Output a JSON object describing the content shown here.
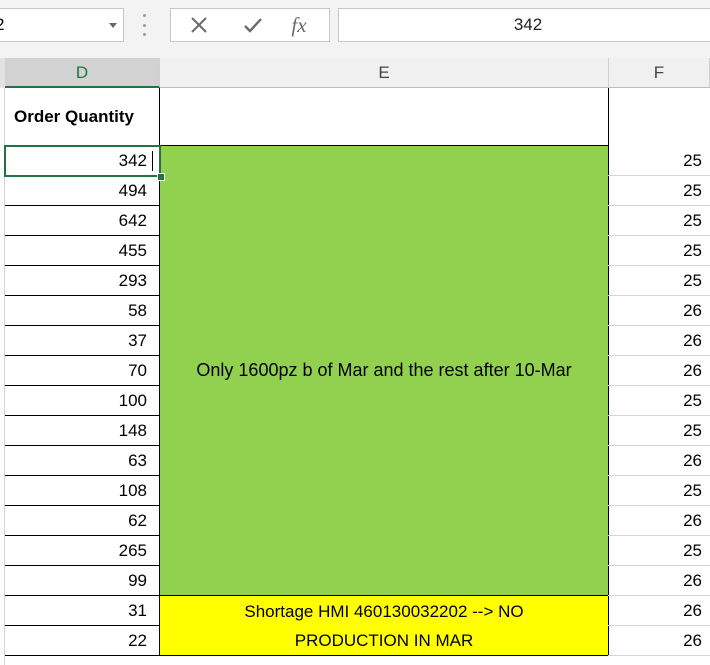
{
  "name_box": {
    "value": "2"
  },
  "formula_bar": {
    "cancel_icon": "x-icon",
    "enter_icon": "check-icon",
    "function_label": "fx",
    "value": "342"
  },
  "columns": {
    "D": "D",
    "E": "E",
    "F": "F"
  },
  "header": {
    "order_quantity": "Order Quantity"
  },
  "order_quantities": [
    "342",
    "494",
    "642",
    "455",
    "293",
    "58",
    "37",
    "70",
    "100",
    "148",
    "63",
    "108",
    "62",
    "265",
    "99",
    "31",
    "22"
  ],
  "f_values": [
    "25",
    "25",
    "25",
    "25",
    "25",
    "26",
    "26",
    "26",
    "25",
    "25",
    "26",
    "25",
    "26",
    "25",
    "26",
    "26",
    "26"
  ],
  "merged_notes": {
    "green": "Only 1600pz b of Mar and the rest after 10-Mar",
    "yellow": "Shortage HMI 460130032202 --> NO PRODUCTION IN MAR"
  },
  "colors": {
    "green_fill": "#92d050",
    "yellow_fill": "#ffff00",
    "selection": "#217346"
  }
}
